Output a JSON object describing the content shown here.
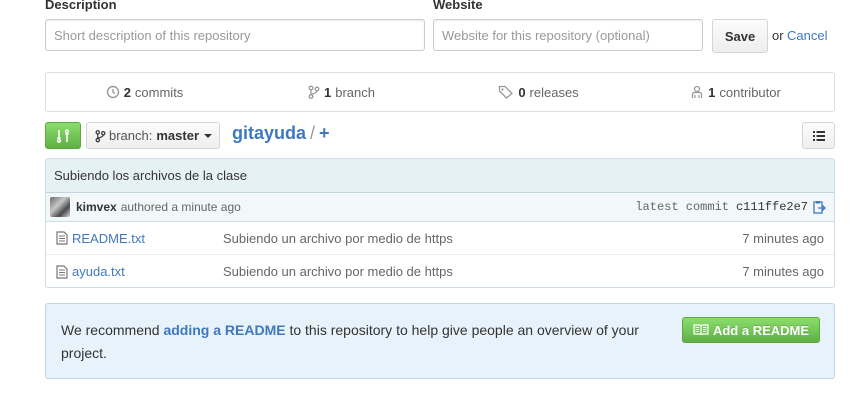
{
  "settings": {
    "description_label": "Description",
    "description_placeholder": "Short description of this repository",
    "website_label": "Website",
    "website_placeholder": "Website for this repository (optional)",
    "save_label": "Save",
    "or_text": "or",
    "cancel_label": "Cancel"
  },
  "summary": {
    "commits_count": "2",
    "commits_label": "commits",
    "branches_count": "1",
    "branches_label": "branch",
    "releases_count": "0",
    "releases_label": "releases",
    "contributors_count": "1",
    "contributors_label": "contributor"
  },
  "toolbar": {
    "branch_prefix": "branch:",
    "branch_name": "master",
    "repo_name": "gitayuda",
    "separator": "/",
    "plus": "+"
  },
  "commit": {
    "message": "Subiendo los archivos de la clase",
    "author": "kimvex",
    "authored_text": "authored a minute ago",
    "latest_label": "latest commit",
    "sha": "c111ffe2e7"
  },
  "files": [
    {
      "name": "README.txt",
      "message": "Subiendo un archivo por medio de https",
      "age": "7 minutes ago"
    },
    {
      "name": "ayuda.txt",
      "message": "Subiendo un archivo por medio de https",
      "age": "7 minutes ago"
    }
  ],
  "readme_prompt": {
    "text_before": "We recommend ",
    "link_text": "adding a README",
    "text_after": " to this repository to help give people an overview of your project.",
    "button_label": "Add a README"
  },
  "colors": {
    "accent_link": "#4078c0",
    "green_button": "#60b044",
    "commit_bar": "#e6f1f6",
    "readme_bg": "#e7f2fa"
  }
}
